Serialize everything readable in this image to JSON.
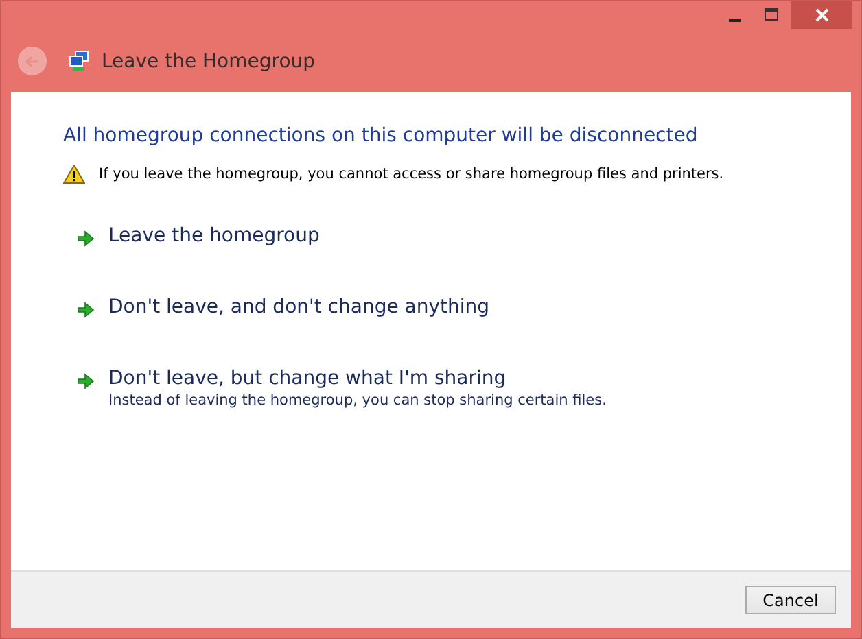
{
  "nav": {
    "back_disabled": true,
    "title": "Leave the Homegroup"
  },
  "heading": "All homegroup connections on this computer will be disconnected",
  "warning": "If you leave the homegroup, you cannot access or share homegroup files and printers.",
  "options": [
    {
      "label": "Leave the homegroup"
    },
    {
      "label": "Don't leave, and don't change anything"
    },
    {
      "label": "Don't leave, but change what I'm sharing",
      "description": "Instead of leaving the homegroup, you can stop sharing certain files."
    }
  ],
  "buttons": [
    "Cancel"
  ]
}
